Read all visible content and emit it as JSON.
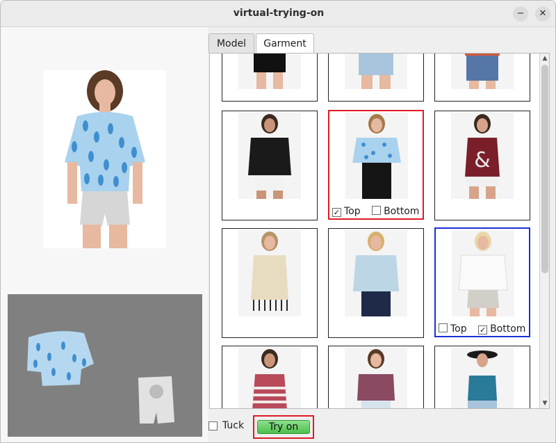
{
  "window": {
    "title": "virtual-trying-on",
    "minimize_icon": "minimize-icon",
    "close_icon": "close-icon"
  },
  "tabs": [
    {
      "label": "Model"
    },
    {
      "label": "Garment",
      "active": true
    }
  ],
  "gallery": {
    "items": [
      {
        "row": 0,
        "col": 0,
        "partial": true
      },
      {
        "row": 0,
        "col": 1,
        "partial": true
      },
      {
        "row": 0,
        "col": 2,
        "partial": true
      },
      {
        "row": 1,
        "col": 0
      },
      {
        "row": 1,
        "col": 1,
        "selection": "red",
        "top_label": "Top",
        "top_checked": true,
        "bottom_label": "Bottom",
        "bottom_checked": false
      },
      {
        "row": 1,
        "col": 2
      },
      {
        "row": 2,
        "col": 0
      },
      {
        "row": 2,
        "col": 1
      },
      {
        "row": 2,
        "col": 2,
        "selection": "blue",
        "top_label": "Top",
        "top_checked": false,
        "bottom_label": "Bottom",
        "bottom_checked": true
      },
      {
        "row": 3,
        "col": 0
      },
      {
        "row": 3,
        "col": 1
      },
      {
        "row": 3,
        "col": 2
      }
    ]
  },
  "controls": {
    "tuck_label": "Tuck",
    "tuck_checked": false,
    "tryon_label": "Try on"
  },
  "colors": {
    "selection_red": "#e01b24",
    "selection_blue": "#1a2fd6",
    "tryon_green": "#4cbf4c",
    "preview_bg": "#808080"
  }
}
